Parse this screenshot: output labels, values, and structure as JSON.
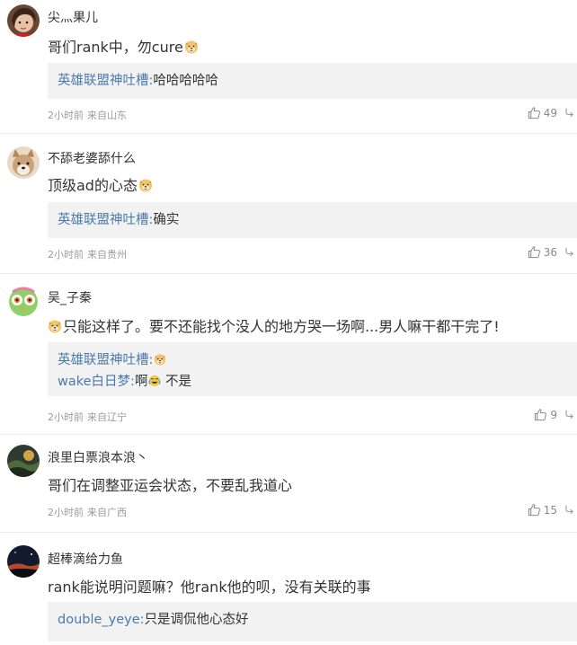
{
  "comments": [
    {
      "username": "尖灬果儿",
      "content": "哥们rank中，勿cure",
      "replies": [
        {
          "author": "英雄联盟神吐槽:",
          "text": "哈哈哈哈哈"
        }
      ],
      "time": "2小时前",
      "location": "来自山东",
      "likes": "49"
    },
    {
      "username": "不舔老婆舔什么",
      "content": "顶级ad的心态",
      "replies": [
        {
          "author": "英雄联盟神吐槽:",
          "text": "确实"
        }
      ],
      "time": "2小时前",
      "location": "来自贵州",
      "likes": "36"
    },
    {
      "username": "吴_子秦",
      "content": "只能这样了。要不还能找个没人的地方哭一场啊...男人嘛干都干完了!",
      "replies": [
        {
          "author": "英雄联盟神吐槽:",
          "text": ""
        },
        {
          "author": "wake白日梦:",
          "text_a": "啊",
          "text_b": " 不是"
        }
      ],
      "time": "2小时前",
      "location": "来自辽宁",
      "likes": "9"
    },
    {
      "username": "浪里白票浪本浪丶",
      "content": "哥们在调整亚运会状态，不要乱我道心",
      "replies": [],
      "time": "2小时前",
      "location": "来自广西",
      "likes": "15"
    },
    {
      "username": "超棒滴给力鱼",
      "content": "rank能说明问题嘛？他rank他的呗，没有关联的事",
      "replies": [
        {
          "author": "double_yeye:",
          "text": "只是调侃他心态好"
        }
      ]
    }
  ],
  "icons": {
    "like": "thumbs-up-icon",
    "reply": "reply-icon",
    "emoji": "doge-emoji-icon"
  },
  "colors": {
    "reply_author": "#4a7aab",
    "reply_background": "#f2f2f2",
    "meta_text": "#9b9b9b"
  }
}
